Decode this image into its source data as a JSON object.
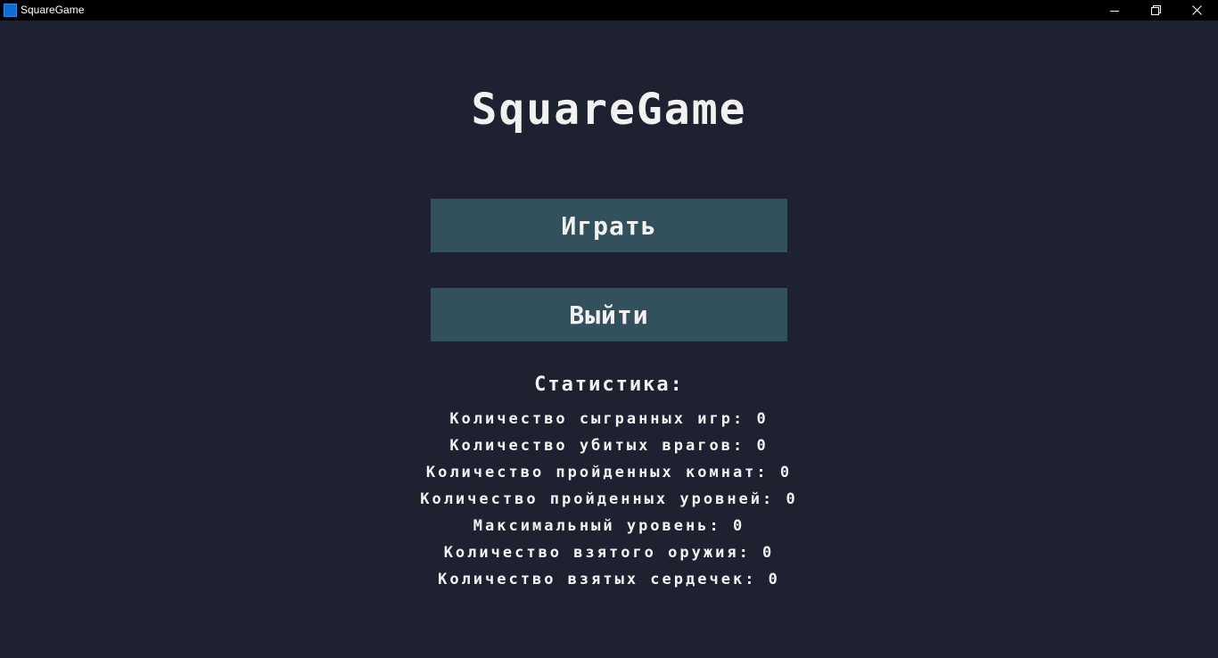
{
  "window": {
    "title": "SquareGame",
    "icon": "app-icon"
  },
  "game": {
    "title": "SquareGame",
    "menu": {
      "play_label": "Играть",
      "exit_label": "Выйти"
    },
    "stats": {
      "heading": "Статистика:",
      "lines": [
        {
          "label": "Количество сыгранных игр",
          "value": "0"
        },
        {
          "label": "Количество убитых врагов",
          "value": "0"
        },
        {
          "label": "Количество пройденных комнат",
          "value": "0"
        },
        {
          "label": "Количество пройденных уровней",
          "value": "0"
        },
        {
          "label": "Максимальный уровень",
          "value": "0"
        },
        {
          "label": "Количество взятого оружия",
          "value": "0"
        },
        {
          "label": "Количество взятых сердечек",
          "value": "0"
        }
      ]
    }
  },
  "colors": {
    "background": "#1e2130",
    "button": "#33515c",
    "text": "#f2f2f2",
    "titlebar": "#000000",
    "icon": "#0a6fd1"
  }
}
